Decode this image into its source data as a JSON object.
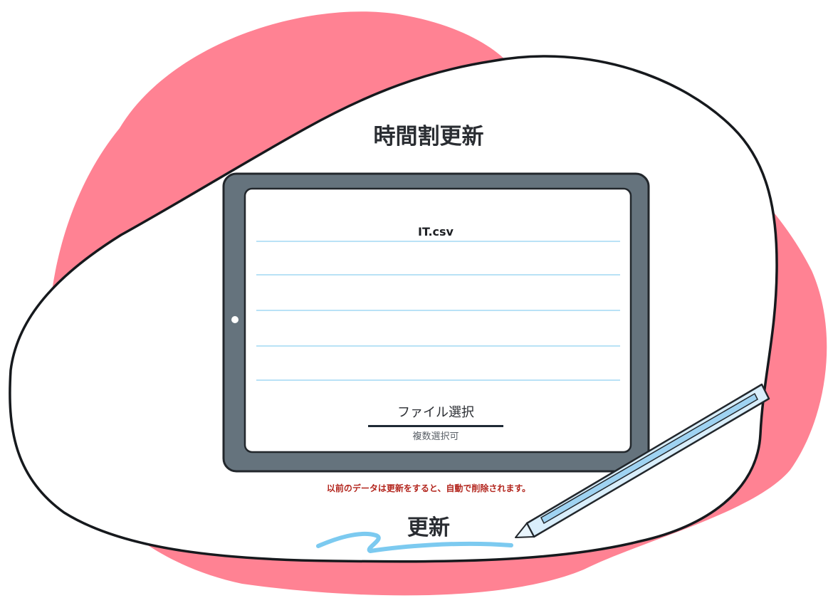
{
  "page": {
    "title": "時間割更新"
  },
  "file_panel": {
    "file_name": "IT.csv",
    "list_rows": [
      "",
      "",
      "",
      "",
      ""
    ],
    "select_label": "ファイル選択",
    "select_note": "複数選択可"
  },
  "warning": {
    "text": "以前のデータは更新をすると、自動で削除されます。",
    "color": "#b3261e"
  },
  "actions": {
    "update_label": "更新"
  },
  "colors": {
    "accent_blob": "#ff8293",
    "tablet_frame": "#65737d",
    "row_line": "#b9e2f6",
    "brush_stroke": "#7ccaf0",
    "pencil_body": "#d9eefb"
  },
  "icons": {
    "tablet": "tablet-icon",
    "pencil": "pencil-icon",
    "brush": "brush-stroke-icon"
  }
}
